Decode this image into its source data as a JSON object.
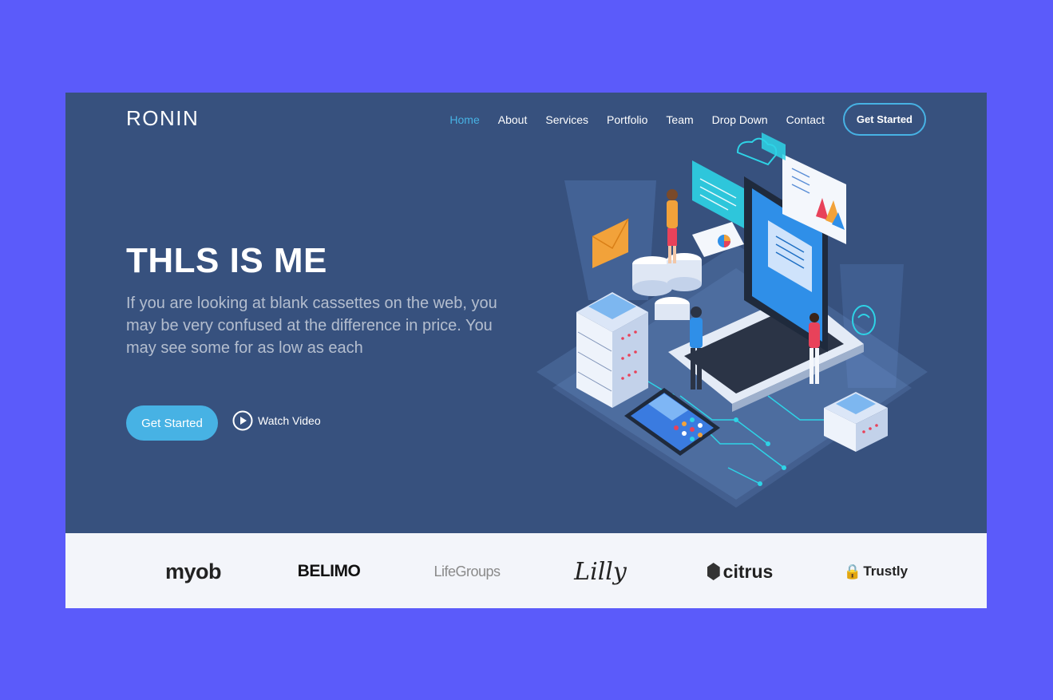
{
  "brand": "RONIN",
  "nav": {
    "items": [
      "Home",
      "About",
      "Services",
      "Portfolio",
      "Team",
      "Drop Down",
      "Contact"
    ],
    "active": "Home",
    "cta": "Get Started"
  },
  "hero": {
    "title": "THLS IS ME",
    "lead": "If you are looking at blank cassettes on the web, you may be very confused at the difference in price. You may see some for as low as each",
    "primary_button": "Get Started",
    "video_button": "Watch Video",
    "illustration_icon": "tech-isometric-illustration"
  },
  "clients": [
    "myob",
    "BELIMO",
    "LifeGroups",
    "Lilly",
    "citrus",
    "Trustly"
  ],
  "colors": {
    "page_bg": "#5b5bfa",
    "hero_bg": "#37517e",
    "accent": "#47b2e4",
    "clients_bg": "#f3f5fa"
  }
}
